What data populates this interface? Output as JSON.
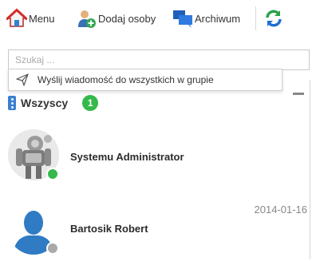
{
  "toolbar": {
    "menu_label": "Menu",
    "add_people_label": "Dodaj osoby",
    "archive_label": "Archiwum",
    "refresh_icon": "refresh-icon"
  },
  "search": {
    "placeholder": "Szukaj ...",
    "value": ""
  },
  "broadcast": {
    "label": "Wyślij wiadomość do wszystkich w grupie",
    "icon": "send-icon"
  },
  "group": {
    "name": "Wszyscy",
    "count": "1",
    "count_color": "#34b94a"
  },
  "contacts": [
    {
      "name": "Systemu Administrator",
      "date": "",
      "status": "online",
      "status_color": "#34b94a"
    },
    {
      "name": "Bartosik Robert",
      "date": "2014-01-16",
      "status": "offline",
      "status_color": "#a9a9a9"
    }
  ],
  "colors": {
    "accent": "#3a7fd2",
    "online": "#34b94a",
    "offline": "#a9a9a9"
  }
}
